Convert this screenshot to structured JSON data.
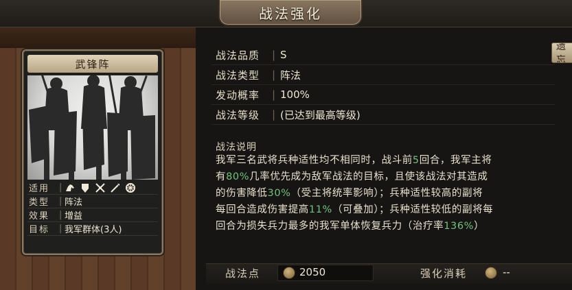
{
  "window": {
    "title": "战法强化"
  },
  "card": {
    "name": "武锋阵",
    "attrs": {
      "suitable_label": "适用",
      "type_label": "类型",
      "type_value": "阵法",
      "effect_label": "效果",
      "effect_value": "增益",
      "target_label": "目标",
      "target_value": "我军群体(3人)"
    },
    "suitable_icons": [
      "cavalry-icon",
      "shield-icon",
      "crossbow-icon",
      "spear-icon",
      "wheel-icon"
    ]
  },
  "info": {
    "quality_label": "战法品质",
    "quality_value": "S",
    "type_label": "战法类型",
    "type_value": "阵法",
    "rate_label": "发动概率",
    "rate_value": "100%",
    "level_label": "战法等级",
    "level_value": "(已达到最高等级)"
  },
  "reset_button": "遗忘",
  "description": {
    "title": "战法说明",
    "line1": "我军三名武将兵种适性均不相同时，战斗前",
    "line1_hl": "5",
    "line1_end": "回合，我军主将",
    "line2_start": "有",
    "line2_hl": "80%",
    "line2_end": "几率优先成为敌军战法的目标，且使该战法对其造成",
    "line3_start": "的伤害降低",
    "line3_hl": "30%",
    "line3_end": "（受主将统率影响）；兵种适性较高的副将",
    "line4_start": "每回合造成伤害提高",
    "line4_hl": "11%",
    "line4_end": "（可叠加）；兵种适性较低的副将每",
    "line5_start": "回合为损失兵力最多的我军单体恢复兵力（治疗率",
    "line5_hl": "136%",
    "line5_end": "）"
  },
  "bottom": {
    "points_label": "战法点",
    "points_value": "2050",
    "cost_label": "强化消耗",
    "cost_value": "--"
  },
  "colors": {
    "highlight": "#6fc47a",
    "panel": "#161513",
    "wood": "#5a3a26"
  }
}
